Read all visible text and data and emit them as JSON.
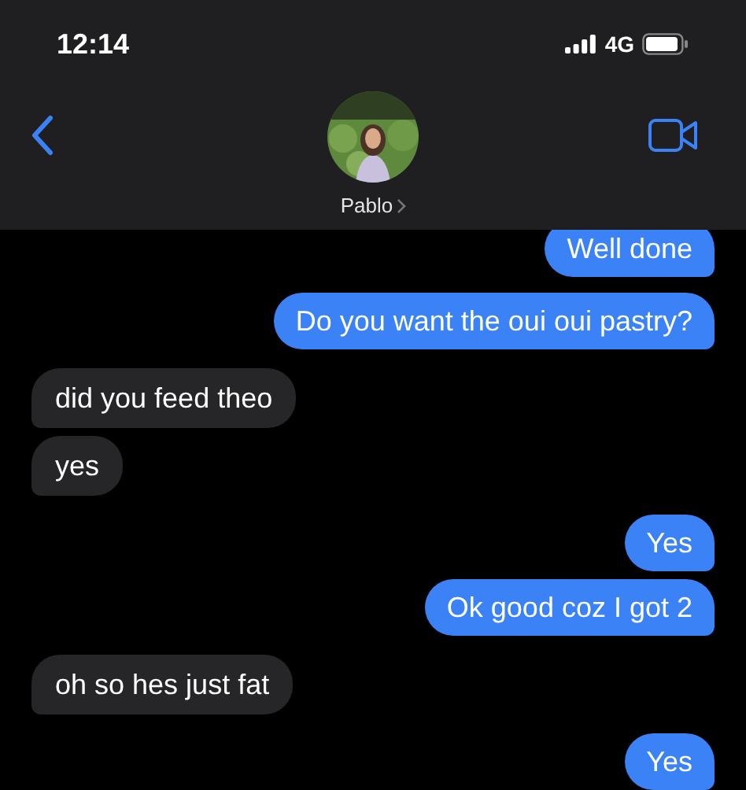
{
  "status_bar": {
    "time": "12:14",
    "network": "4G"
  },
  "header": {
    "contact_name": "Pablo"
  },
  "messages": [
    {
      "kind": "sent",
      "text": "Well done"
    },
    {
      "kind": "sent",
      "text": "Do you want the oui oui pastry?"
    },
    {
      "kind": "received",
      "text": "did you feed theo"
    },
    {
      "kind": "received",
      "text": "yes"
    },
    {
      "kind": "sent",
      "text": "Yes"
    },
    {
      "kind": "sent",
      "text": "Ok good coz I got 2"
    },
    {
      "kind": "received",
      "text": "oh so hes just fat"
    },
    {
      "kind": "sent",
      "text": "Yes"
    }
  ]
}
